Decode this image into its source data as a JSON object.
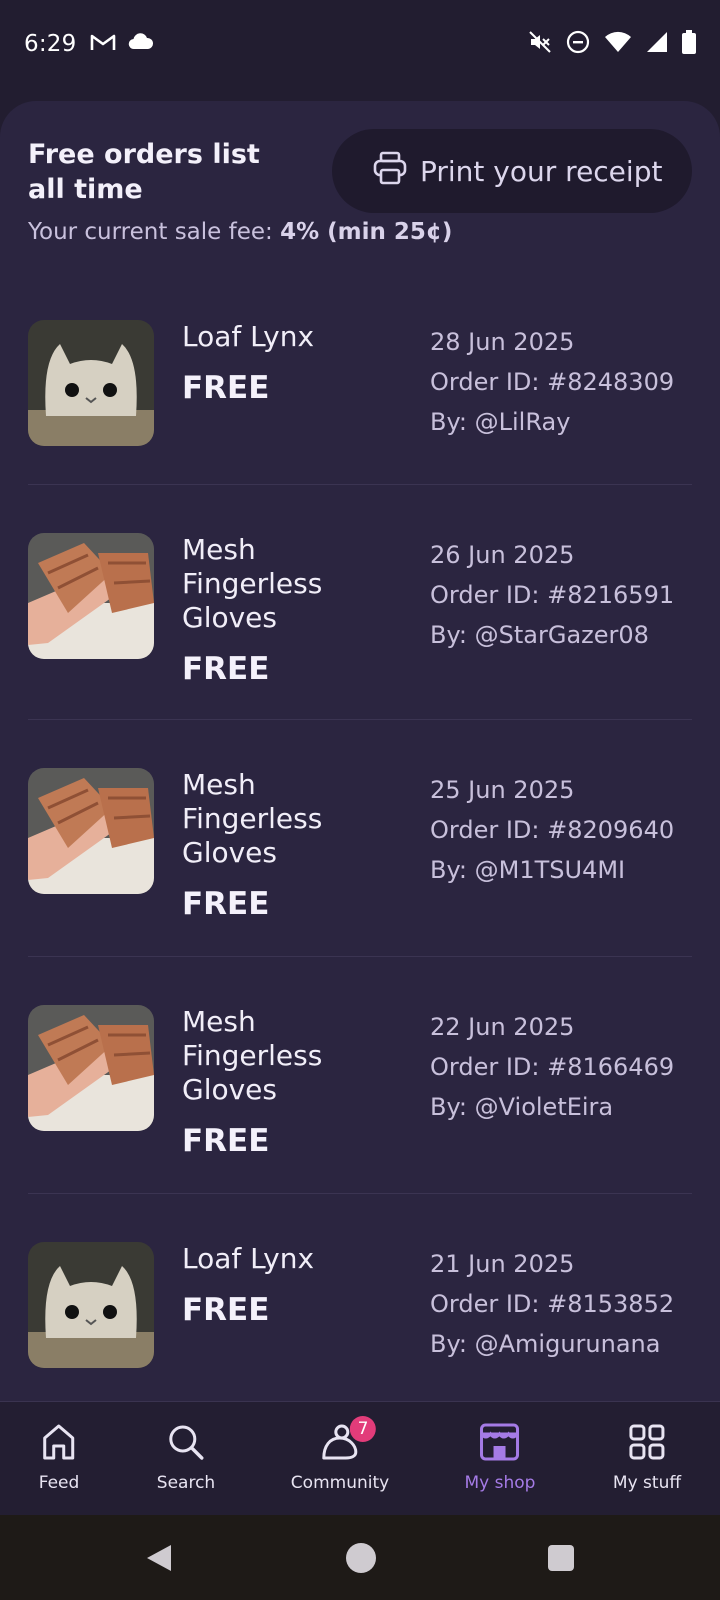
{
  "status_bar": {
    "time": "6:29",
    "left_icons": [
      "gmail-icon",
      "cloud-icon"
    ],
    "right_icons": [
      "mute-icon",
      "do-not-disturb-icon",
      "wifi-icon",
      "signal-icon",
      "battery-icon"
    ]
  },
  "header": {
    "title": "Free orders list all time",
    "print_button_label": "Print your receipt",
    "fee_prefix": "Your current sale fee: ",
    "fee_value": "4% (min 25¢)"
  },
  "orders": [
    {
      "name": "Loaf Lynx",
      "price": "FREE",
      "date": "28 Jun 2025",
      "order_id": "Order ID: #8248309",
      "buyer": "By: @LilRay",
      "thumb": "cat-plush-thumbnail"
    },
    {
      "name": "Mesh Fingerless Gloves",
      "price": "FREE",
      "date": "26 Jun 2025",
      "order_id": "Order ID: #8216591",
      "buyer": "By: @StarGazer08",
      "thumb": "gloves-thumbnail"
    },
    {
      "name": "Mesh Fingerless Gloves",
      "price": "FREE",
      "date": "25 Jun 2025",
      "order_id": "Order ID: #8209640",
      "buyer": "By: @M1TSU4MI",
      "thumb": "gloves-thumbnail"
    },
    {
      "name": "Mesh Fingerless Gloves",
      "price": "FREE",
      "date": "22 Jun 2025",
      "order_id": "Order ID: #8166469",
      "buyer": "By: @VioletEira",
      "thumb": "gloves-thumbnail"
    },
    {
      "name": "Loaf Lynx",
      "price": "FREE",
      "date": "21 Jun 2025",
      "order_id": "Order ID: #8153852",
      "buyer": "By: @Amigurunana",
      "thumb": "cat-plush-thumbnail"
    }
  ],
  "bottom_nav": {
    "items": [
      {
        "label": "Feed",
        "icon": "home-icon"
      },
      {
        "label": "Search",
        "icon": "search-icon"
      },
      {
        "label": "Community",
        "icon": "community-icon",
        "badge": "7"
      },
      {
        "label": "My shop",
        "icon": "shop-icon",
        "active": true
      },
      {
        "label": "My stuff",
        "icon": "grid-icon"
      }
    ]
  },
  "colors": {
    "background": "#221d30",
    "sheet": "#2b2540",
    "accent": "#a57be6",
    "badge": "#e23c7a"
  }
}
